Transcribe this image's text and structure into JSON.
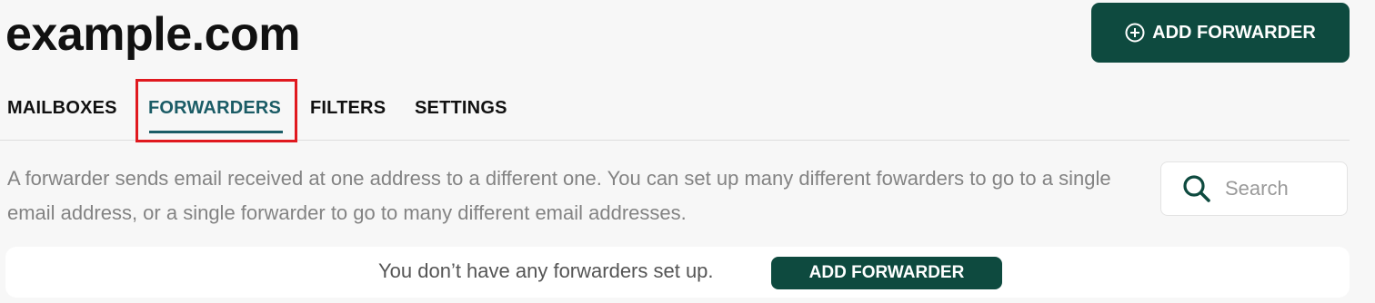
{
  "header": {
    "title": "example.com",
    "add_button_label": "ADD FORWARDER",
    "add_button_icon": "plus-circle-icon"
  },
  "tabs": [
    {
      "label": "MAILBOXES",
      "active": false
    },
    {
      "label": "FORWARDERS",
      "active": true
    },
    {
      "label": "FILTERS",
      "active": false
    },
    {
      "label": "SETTINGS",
      "active": false
    }
  ],
  "description": "A forwarder sends email received at one address to a different one. You can set up many different fowarders to go to a single email address, or a single forwarder to go to many different email addresses.",
  "search": {
    "placeholder": "Search",
    "value": "",
    "icon": "search-icon"
  },
  "empty_state": {
    "message": "You don’t have any forwarders set up.",
    "button_label": "ADD FORWARDER"
  },
  "colors": {
    "primary": "#0e4a3f",
    "active_tab": "#1b5c66",
    "highlight": "#e0191f",
    "background": "#f7f7f7"
  }
}
